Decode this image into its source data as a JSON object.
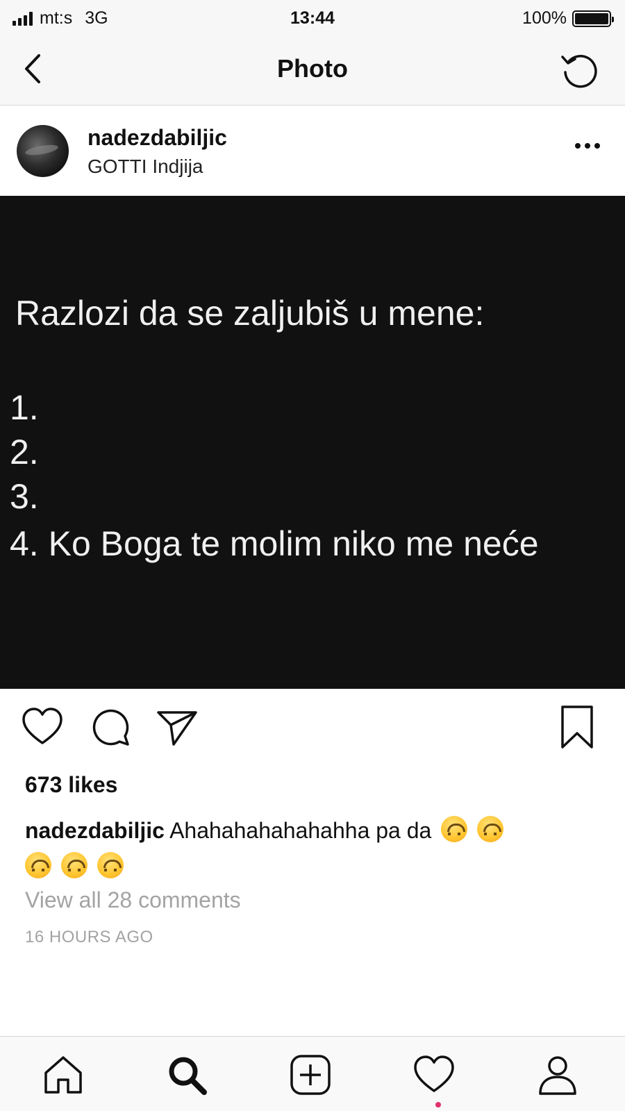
{
  "status_bar": {
    "carrier": "mt:s",
    "network": "3G",
    "time": "13:44",
    "battery": "100%",
    "battery_level": 1.0
  },
  "nav": {
    "title": "Photo",
    "back_icon": "chevron-left-icon",
    "refresh_icon": "refresh-icon"
  },
  "post": {
    "username": "nadezdabiljic",
    "location": "GOTTI Indjija",
    "more_icon": "more-horizontal-icon",
    "image_text": {
      "heading": "Razlozi da se zaljubiš u mene:",
      "items": [
        "1.",
        "2.",
        "3.",
        "4. Ko Boga te molim niko me neće"
      ]
    },
    "likes": "673 likes",
    "caption_user": "nadezdabiljic",
    "caption_text": "Ahahahahahahahha pa da",
    "caption_emoji": "upside-down-face-emoji",
    "caption_emoji_count": 5,
    "view_comments": "View all 28 comments",
    "time_ago": "16 HOURS AGO"
  },
  "actions": {
    "like_icon": "heart-icon",
    "comment_icon": "comment-icon",
    "share_icon": "send-icon",
    "save_icon": "bookmark-icon"
  },
  "tab_bar": {
    "tabs": [
      "home-icon",
      "search-icon",
      "add-post-icon",
      "activity-heart-icon",
      "profile-icon"
    ],
    "accent_color": "#e1306c"
  }
}
